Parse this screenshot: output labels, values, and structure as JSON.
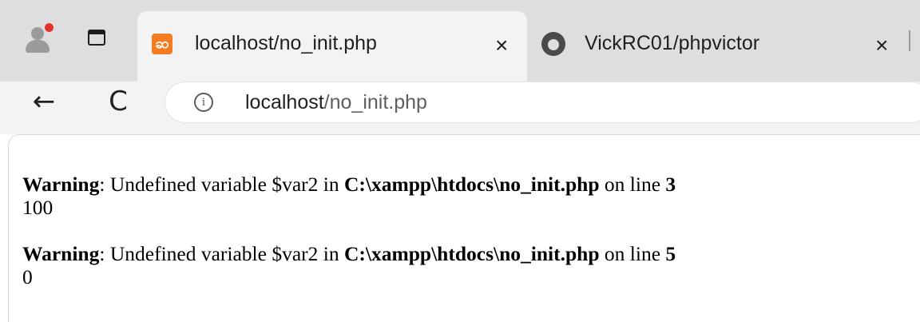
{
  "browser": {
    "tabs": [
      {
        "title": "localhost/no_init.php",
        "close": "×",
        "favicon": "xampp-icon",
        "favicon_glyph": "ဆ"
      },
      {
        "title": "VickRC01/phpvictor",
        "close": "×",
        "favicon": "github-icon"
      }
    ],
    "nav": {
      "back": "←",
      "reload": "C"
    },
    "omnibox": {
      "info_glyph": "i",
      "host": "localhost",
      "path": "/no_init.php"
    },
    "colors": {
      "tabstrip": "#dedede",
      "toolbar": "#f3f3f3",
      "xampp_orange": "#f47c20",
      "profile_dot": "#e4322b"
    }
  },
  "page": {
    "messages": [
      {
        "label": "Warning",
        "separator": ": ",
        "text": "Undefined variable $var2 in ",
        "file": "C:\\xampp\\htdocs\\no_init.php",
        "on_line": " on line ",
        "line": "3",
        "value": "100"
      },
      {
        "label": "Warning",
        "separator": ": ",
        "text": "Undefined variable $var2 in ",
        "file": "C:\\xampp\\htdocs\\no_init.php",
        "on_line": " on line ",
        "line": "5",
        "value": "0"
      }
    ]
  }
}
